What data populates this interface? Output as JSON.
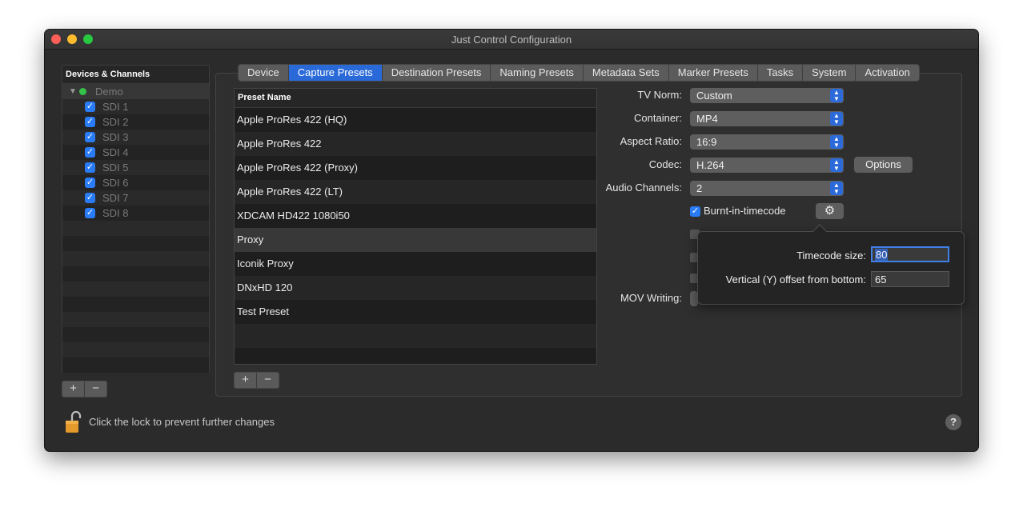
{
  "window": {
    "title": "Just Control Configuration"
  },
  "sidebar": {
    "header": "Devices & Channels",
    "device": "Demo",
    "channels": [
      "SDI 1",
      "SDI 2",
      "SDI 3",
      "SDI 4",
      "SDI 5",
      "SDI 6",
      "SDI 7",
      "SDI 8"
    ],
    "add_label": "+",
    "remove_label": "−"
  },
  "tabs": [
    "Device",
    "Capture Presets",
    "Destination Presets",
    "Naming Presets",
    "Metadata Sets",
    "Marker Presets",
    "Tasks",
    "System",
    "Activation"
  ],
  "active_tab": "Capture Presets",
  "presets": {
    "header": "Preset Name",
    "items": [
      "Apple ProRes 422 (HQ)",
      "Apple ProRes 422",
      "Apple ProRes 422 (Proxy)",
      "Apple ProRes 422 (LT)",
      "XDCAM HD422 1080i50",
      "Proxy",
      "Iconik Proxy",
      "DNxHD 120",
      "Test Preset"
    ],
    "selected": "Proxy",
    "add_label": "+",
    "remove_label": "−"
  },
  "form": {
    "tv_norm_label": "TV Norm:",
    "tv_norm_value": "Custom",
    "container_label": "Container:",
    "container_value": "MP4",
    "aspect_label": "Aspect Ratio:",
    "aspect_value": "16:9",
    "codec_label": "Codec:",
    "codec_value": "H.264",
    "options_label": "Options",
    "audio_label": "Audio Channels:",
    "audio_value": "2",
    "burnt_label": "Burnt-in-timecode",
    "burnt_checked": true,
    "mov_label": "MOV Writing:"
  },
  "popover": {
    "size_label": "Timecode size:",
    "size_value": "80",
    "offset_label": "Vertical (Y) offset from bottom:",
    "offset_value": "65"
  },
  "footer": {
    "lock_text": "Click the lock to prevent further changes",
    "help_label": "?"
  },
  "colors": {
    "accent": "#2a6ad8",
    "window_bg": "#2b2b2b",
    "status_green": "#35c24a",
    "lock_orange": "#e39a2b"
  }
}
